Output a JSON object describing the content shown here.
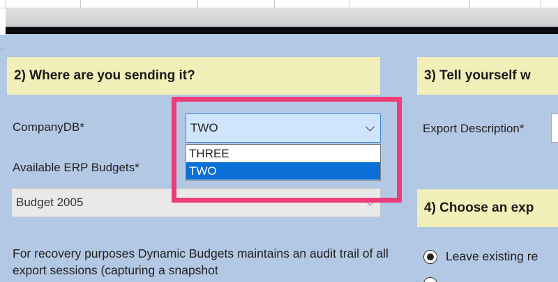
{
  "section2": {
    "title": "2) Where are you sending it?",
    "company_db_label": "CompanyDB*",
    "company_db_value": "TWO",
    "company_db_options": [
      "THREE",
      "TWO"
    ],
    "budgets_label": "Available ERP Budgets*",
    "budget_value": "Budget 2005",
    "info_text": "For recovery purposes Dynamic Budgets maintains an audit trail of all export sessions (capturing a snapshot"
  },
  "section3": {
    "title": "3) Tell yourself w",
    "export_description_label": "Export Description*"
  },
  "section4": {
    "title": "4) Choose an exp",
    "option1_label": "Leave existing re"
  },
  "colors": {
    "background": "#b3c8e4",
    "header": "#f3efb9",
    "highlight": "#ec3d78",
    "selection": "#0a6fd6"
  }
}
